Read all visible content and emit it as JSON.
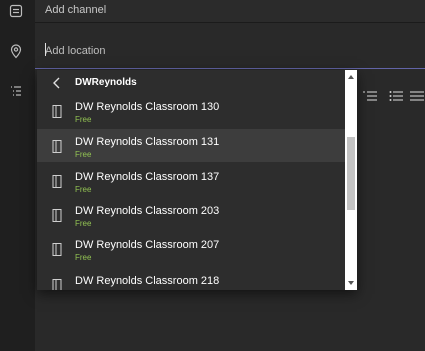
{
  "channel_row": {
    "label": "Add channel",
    "icon": "channel-icon"
  },
  "location_row": {
    "placeholder": "Add location",
    "icon": "location-pin-icon"
  },
  "rail": {
    "icon": "details-list-icon"
  },
  "dropdown": {
    "back_icon": "chevron-left-icon",
    "title": "DWReynolds",
    "rooms": [
      {
        "name": "DW Reynolds Classroom 130",
        "status": "Free",
        "icon": "door-icon"
      },
      {
        "name": "DW Reynolds Classroom 131",
        "status": "Free",
        "icon": "door-icon",
        "selected": true
      },
      {
        "name": "DW Reynolds Classroom 137",
        "status": "Free",
        "icon": "door-icon"
      },
      {
        "name": "DW Reynolds Classroom 203",
        "status": "Free",
        "icon": "door-icon"
      },
      {
        "name": "DW Reynolds Classroom 207",
        "status": "Free",
        "icon": "door-icon"
      },
      {
        "name": "DW Reynolds Classroom 218",
        "status": "",
        "icon": "door-icon"
      }
    ]
  },
  "editor_toolbar": {
    "icons": [
      "numbered-list-icon",
      "bulleted-list-icon",
      "list-icon"
    ]
  },
  "colors": {
    "accent": "#6264a7",
    "status_free": "#92c353",
    "background": "#1f1f1f",
    "dropdown_bg": "#2d2d2d",
    "selected_bg": "#3d3d3d"
  }
}
